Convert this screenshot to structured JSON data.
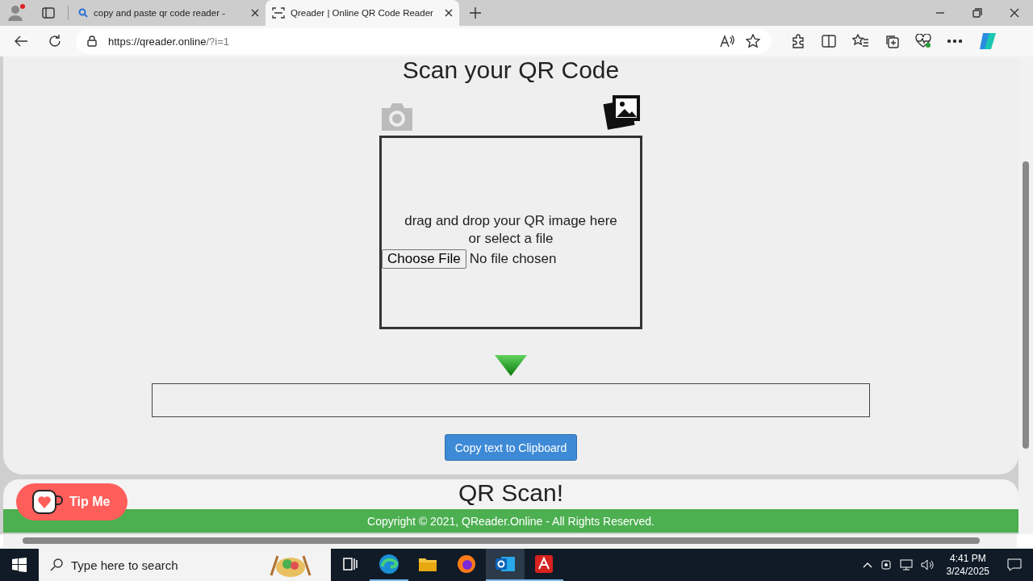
{
  "browser": {
    "tabs": [
      {
        "title": "copy and paste qr code reader -",
        "selected": false,
        "kind": "search"
      },
      {
        "title": "Qreader | Online QR Code Reader",
        "selected": true,
        "kind": "scan"
      }
    ],
    "address_host": "https://qreader.online",
    "address_path": "/?i=1"
  },
  "page": {
    "title": "Scan your QR Code",
    "drop_hint": "drag and drop your QR image here",
    "drop_hint_2": "or select a file",
    "file_button": "Choose File",
    "file_status": "No file chosen",
    "copy_button": "Copy text to Clipboard",
    "section_title": "QR Scan!",
    "tip_button": "Tip Me",
    "footer": "Copyright © 2021, QReader.Online - All Rights Reserved."
  },
  "taskbar": {
    "search": {
      "placeholder": "Type here to search"
    },
    "apps": [
      {
        "kind": "taskview",
        "running": false,
        "selected": false
      },
      {
        "kind": "edge",
        "running": true,
        "selected": false
      },
      {
        "kind": "explorer",
        "running": false,
        "selected": false
      },
      {
        "kind": "firefox",
        "running": false,
        "selected": false
      },
      {
        "kind": "outlook",
        "running": true,
        "selected": true
      },
      {
        "kind": "acrobat",
        "running": true,
        "selected": false
      }
    ],
    "time": "4:41 PM",
    "date": "3/24/2025"
  }
}
